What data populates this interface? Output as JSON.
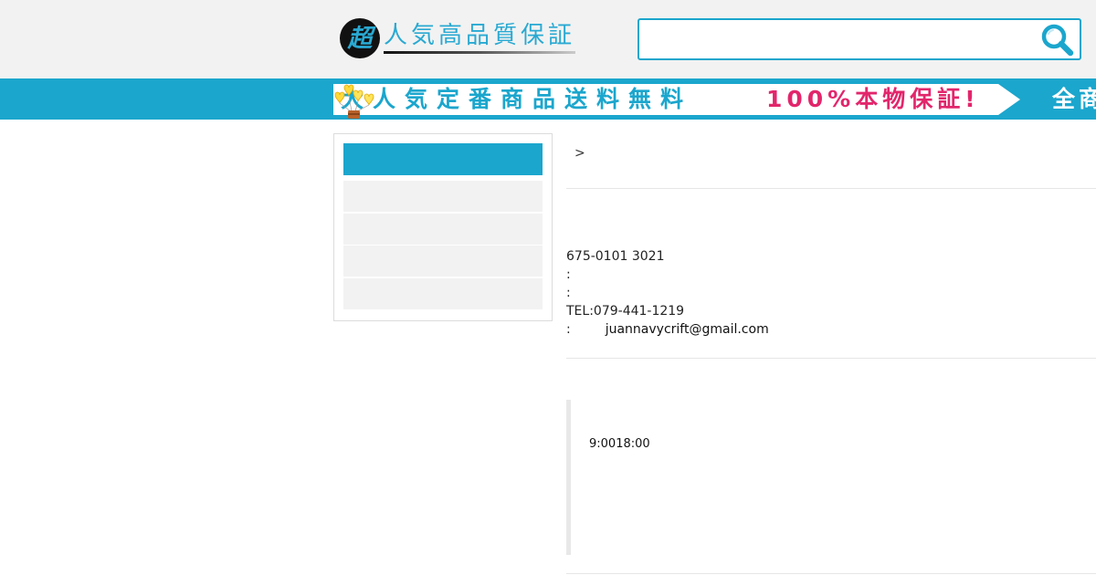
{
  "header": {
    "logo_mark": "超",
    "logo_text": "人気高品質保証",
    "search": {
      "value": "",
      "placeholder": ""
    }
  },
  "banner": {
    "text_a": "大人気定番商品送料無料",
    "text_b": "100%本物保証!",
    "text_next": "全商",
    "colors": {
      "background": "#1ba6cd",
      "strip": "#ffffff",
      "text_a": "#1ba6cd",
      "text_b": "#e2266c"
    }
  },
  "sidebar": {
    "head_label": "",
    "items": [
      {
        "label": ""
      },
      {
        "label": ""
      },
      {
        "label": ""
      },
      {
        "label": ""
      }
    ]
  },
  "breadcrumb": {
    "separator": ">"
  },
  "contact": {
    "postal": "675-0101 3021",
    "line2": ":",
    "line3": ":",
    "tel": "TEL:079-441-1219",
    "mail_prefix": ":",
    "email": "juannavycrift@gmail.com"
  },
  "hours": {
    "text": "9:0018:00"
  },
  "icons": {
    "search": "search-icon",
    "banner_arrow": "arrow-right-icon",
    "balloon": "heart-balloon-icon"
  },
  "colors": {
    "accent": "#1ba6cd",
    "header_bg": "#f2f2f2",
    "sidebar_item_bg": "#f2f2f2"
  }
}
